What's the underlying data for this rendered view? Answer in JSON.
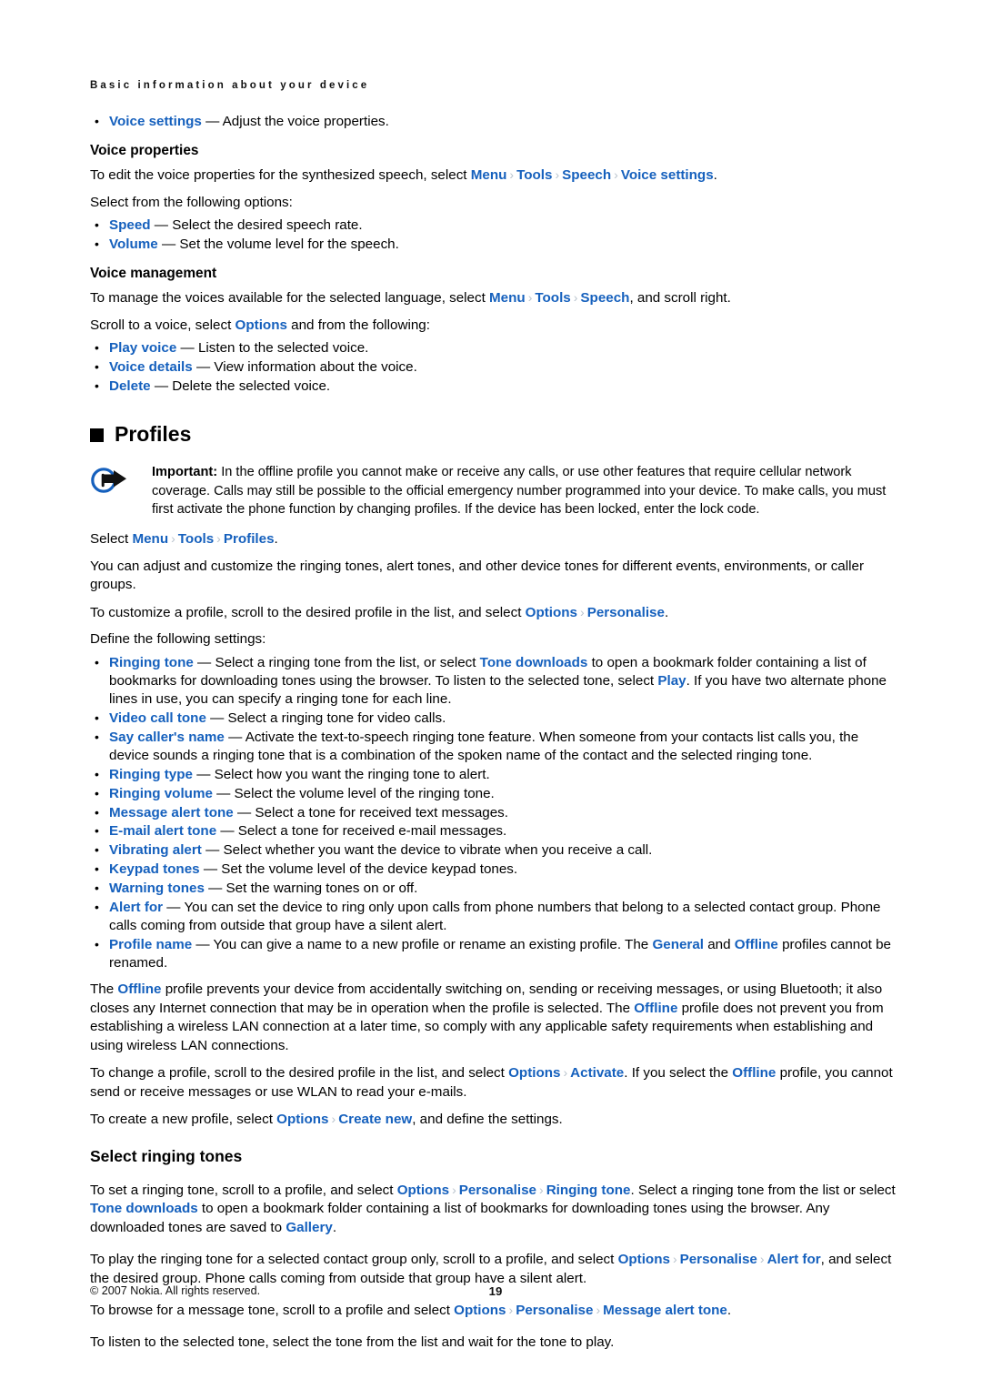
{
  "page": {
    "running_header": "Basic information about your device",
    "footer_copyright": "© 2007 Nokia. All rights reserved.",
    "page_number": "19",
    "link_color": "#1560bd",
    "separator_glyph": "›"
  },
  "voice_settings_bullet": {
    "term": "Voice settings",
    "dash": " — ",
    "desc": "Adjust the voice properties."
  },
  "voice_properties": {
    "heading": "Voice properties",
    "intro_prefix": "To edit the voice properties for the synthesized speech, select ",
    "path": [
      "Menu",
      "Tools",
      "Speech",
      "Voice settings"
    ],
    "intro_suffix": ".",
    "options_lead": "Select from the following options:",
    "options": [
      {
        "term": "Speed",
        "dash": " — ",
        "desc": "Select the desired speech rate."
      },
      {
        "term": "Volume",
        "dash": " — ",
        "desc": "Set the volume level for the speech."
      }
    ]
  },
  "voice_management": {
    "heading": "Voice management",
    "intro_prefix": "To manage the voices available for the selected language, select ",
    "path": [
      "Menu",
      "Tools",
      "Speech"
    ],
    "intro_suffix": ", and scroll right.",
    "scroll_prefix": "Scroll to a voice, select ",
    "scroll_link": "Options",
    "scroll_suffix": " and from the following:",
    "options": [
      {
        "term": "Play voice",
        "dash": " — ",
        "desc": "Listen to the selected voice."
      },
      {
        "term": "Voice details",
        "dash": " — ",
        "desc": "View information about the voice."
      },
      {
        "term": "Delete",
        "dash": " — ",
        "desc": "Delete the selected voice."
      }
    ]
  },
  "profiles": {
    "chapter_title": "Profiles",
    "note_icon_name": "important-arrow-icon",
    "note_label": "Important:",
    "note_text": " In the offline profile you cannot make or receive any calls, or use other features that require cellular network coverage. Calls may still be possible to the official emergency number programmed into your device. To make calls, you must first activate the phone function by changing profiles. If the device has been locked, enter the lock code.",
    "select_prefix": "Select ",
    "select_path": [
      "Menu",
      "Tools",
      "Profiles"
    ],
    "select_suffix": ".",
    "intro": "You can adjust and customize the ringing tones, alert tones, and other device tones for different events, environments, or caller groups.",
    "customize_prefix": "To customize a profile, scroll to the desired profile in the list, and select ",
    "customize_path": [
      "Options",
      "Personalise"
    ],
    "customize_suffix": ".",
    "define_lead": "Define the following settings:",
    "settings": [
      {
        "term": "Ringing tone",
        "dash": " — ",
        "parts": [
          {
            "t": "text",
            "v": " Select a ringing tone from the list, or select "
          },
          {
            "t": "ref",
            "v": "Tone downloads"
          },
          {
            "t": "text",
            "v": " to open a bookmark folder containing a list of bookmarks for downloading tones using the browser. To listen to the selected tone, select "
          },
          {
            "t": "ref",
            "v": "Play"
          },
          {
            "t": "text",
            "v": ". If you have two alternate phone lines in use, you can specify a ringing tone for each line."
          }
        ]
      },
      {
        "term": "Video call tone",
        "dash": " — ",
        "parts": [
          {
            "t": "text",
            "v": " Select a ringing tone for video calls."
          }
        ]
      },
      {
        "term": "Say caller's name",
        "dash": " — ",
        "parts": [
          {
            "t": "text",
            "v": " Activate the text-to-speech ringing tone feature. When someone from your contacts list calls you, the device sounds a ringing tone that is a combination of the spoken name of the contact and the selected ringing tone."
          }
        ]
      },
      {
        "term": "Ringing type",
        "dash": " — ",
        "parts": [
          {
            "t": "text",
            "v": " Select how you want the ringing tone to alert."
          }
        ]
      },
      {
        "term": "Ringing volume",
        "dash": " — ",
        "parts": [
          {
            "t": "text",
            "v": " Select the volume level of the ringing tone."
          }
        ]
      },
      {
        "term": "Message alert tone",
        "dash": " — ",
        "parts": [
          {
            "t": "text",
            "v": " Select a tone for received text messages."
          }
        ]
      },
      {
        "term": "E-mail alert tone",
        "dash": " — ",
        "parts": [
          {
            "t": "text",
            "v": " Select a tone for received e-mail messages."
          }
        ]
      },
      {
        "term": "Vibrating alert",
        "dash": " — ",
        "parts": [
          {
            "t": "text",
            "v": " Select whether you want the device to vibrate when you receive a call."
          }
        ]
      },
      {
        "term": "Keypad tones",
        "dash": " — ",
        "parts": [
          {
            "t": "text",
            "v": " Set the volume level of the device keypad tones."
          }
        ]
      },
      {
        "term": "Warning tones",
        "dash": " — ",
        "parts": [
          {
            "t": "text",
            "v": " Set the warning tones on or off."
          }
        ]
      },
      {
        "term": "Alert for",
        "dash": " — ",
        "parts": [
          {
            "t": "text",
            "v": " You can set the device to ring only upon calls from phone numbers that belong to a selected contact group. Phone calls coming from outside that group have a silent alert."
          }
        ]
      },
      {
        "term": "Profile name",
        "dash": " — ",
        "parts": [
          {
            "t": "text",
            "v": " You can give a name to a new profile or rename an existing profile. The "
          },
          {
            "t": "ref",
            "v": "General"
          },
          {
            "t": "text",
            "v": " and "
          },
          {
            "t": "ref",
            "v": "Offline"
          },
          {
            "t": "text",
            "v": " profiles cannot be renamed."
          }
        ]
      }
    ],
    "offline_para": [
      {
        "t": "text",
        "v": "The "
      },
      {
        "t": "ref",
        "v": "Offline"
      },
      {
        "t": "text",
        "v": " profile prevents your device from accidentally switching on, sending or receiving messages, or using Bluetooth; it also closes any Internet connection that may be in operation when the profile is selected. The "
      },
      {
        "t": "ref",
        "v": "Offline"
      },
      {
        "t": "text",
        "v": " profile does not prevent you from establishing a wireless LAN connection at a later time, so comply with any applicable safety requirements when establishing and using wireless LAN connections."
      }
    ],
    "change_para": [
      {
        "t": "text",
        "v": "To change a profile, scroll to the desired profile in the list, and select "
      },
      {
        "t": "ref",
        "v": "Options"
      },
      {
        "t": "sep",
        "v": "›"
      },
      {
        "t": "ref",
        "v": "Activate"
      },
      {
        "t": "text",
        "v": ". If you select the "
      },
      {
        "t": "ref",
        "v": "Offline"
      },
      {
        "t": "text",
        "v": " profile, you cannot send or receive messages or use WLAN to read your e-mails."
      }
    ],
    "create_para": [
      {
        "t": "text",
        "v": "To create a new profile, select "
      },
      {
        "t": "ref",
        "v": "Options"
      },
      {
        "t": "sep",
        "v": "›"
      },
      {
        "t": "ref",
        "v": "Create new"
      },
      {
        "t": "text",
        "v": ", and define the settings."
      }
    ]
  },
  "select_ringing_tones": {
    "heading": "Select ringing tones",
    "p1": [
      {
        "t": "text",
        "v": "To set a ringing tone, scroll to a profile, and select "
      },
      {
        "t": "ref",
        "v": "Options"
      },
      {
        "t": "sep",
        "v": "›"
      },
      {
        "t": "ref",
        "v": "Personalise"
      },
      {
        "t": "sep",
        "v": "›"
      },
      {
        "t": "ref",
        "v": "Ringing tone"
      },
      {
        "t": "text",
        "v": ". Select a ringing tone from the list or select "
      },
      {
        "t": "ref",
        "v": "Tone downloads"
      },
      {
        "t": "text",
        "v": " to open a bookmark folder containing a list of bookmarks for downloading tones using the browser. Any downloaded tones are saved to "
      },
      {
        "t": "ref",
        "v": "Gallery"
      },
      {
        "t": "text",
        "v": "."
      }
    ],
    "p2": [
      {
        "t": "text",
        "v": "To play the ringing tone for a selected contact group only, scroll to a profile, and select "
      },
      {
        "t": "ref",
        "v": "Options"
      },
      {
        "t": "sep",
        "v": "›"
      },
      {
        "t": "ref",
        "v": "Personalise"
      },
      {
        "t": "sep",
        "v": "›"
      },
      {
        "t": "ref",
        "v": "Alert for"
      },
      {
        "t": "text",
        "v": ", and select the desired group. Phone calls coming from outside that group have a silent alert."
      }
    ],
    "p3": [
      {
        "t": "text",
        "v": "To browse for a message tone, scroll to a profile and select "
      },
      {
        "t": "ref",
        "v": "Options"
      },
      {
        "t": "sep",
        "v": "›"
      },
      {
        "t": "ref",
        "v": "Personalise"
      },
      {
        "t": "sep",
        "v": "›"
      },
      {
        "t": "ref",
        "v": "Message alert tone"
      },
      {
        "t": "text",
        "v": "."
      }
    ],
    "p4": [
      {
        "t": "text",
        "v": "To listen to the selected tone, select the tone from the list and wait for the tone to play."
      }
    ]
  }
}
